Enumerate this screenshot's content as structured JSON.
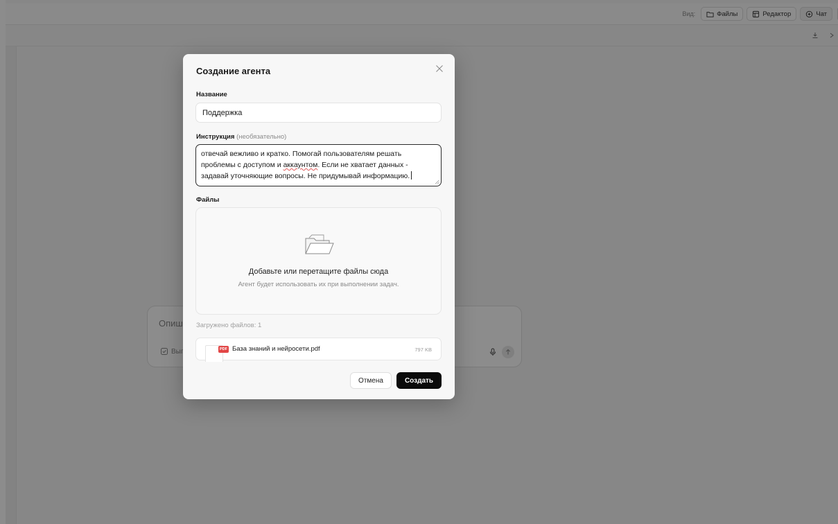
{
  "topbar": {
    "view_label": "Вид:",
    "buttons": [
      {
        "label": "Файлы",
        "icon": "folder-icon"
      },
      {
        "label": "Редактор",
        "icon": "editor-icon"
      },
      {
        "label": "Чат",
        "icon": "chat-icon"
      }
    ]
  },
  "chat": {
    "placeholder": "Опиши",
    "tool_label": "Вып"
  },
  "modal": {
    "title": "Создание агента",
    "name_label": "Название",
    "name_value": "Поддержка",
    "instruction_label": "Инструкция",
    "instruction_optional": "(необязательно)",
    "instruction_part1": "отвечай вежливо и кратко. Помогай пользователям решать проблемы с доступом и ",
    "instruction_misspelled": "аккаунтом",
    "instruction_part2": ". Если не хватает данных - задавай уточняющие вопросы. Не придумывай информацию.",
    "files_label": "Файлы",
    "dropzone_title": "Добавьте или перетащите файлы сюда",
    "dropzone_subtitle": "Агент будет использовать их при выполнении задач.",
    "uploaded_label": "Загружено файлов: 1",
    "file": {
      "badge": "PDF",
      "name": "База знаний и нейросети.pdf",
      "size": "797 KB"
    },
    "cancel_label": "Отмена",
    "create_label": "Создать"
  },
  "colors": {
    "overlay": "#00000073",
    "primary_button": "#0a0a0a",
    "pdf_badge": "#e24646"
  }
}
